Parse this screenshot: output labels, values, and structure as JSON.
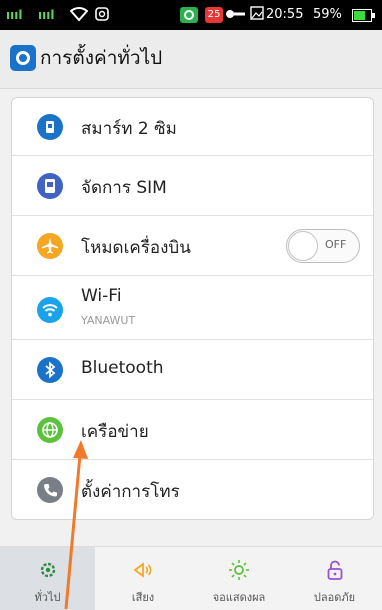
{
  "status_bar": {
    "signal1": "ıııl",
    "signal2": "ıııl",
    "wifi_icon": "wifi-icon",
    "screenshot_icon": "screenshot-icon",
    "badge_number": "25",
    "time": "20:55",
    "battery": "59%"
  },
  "header": {
    "title": "การตั้งค่าทั่วไป",
    "icon": "settings-icon"
  },
  "settings": {
    "smart_dual_sim": {
      "label": "สมาร์ท 2 ซิม",
      "icon": "sim-card-icon"
    },
    "manage_sim": {
      "label": "จัดการ SIM",
      "icon": "sim-manager-icon"
    },
    "airplane_mode": {
      "label": "โหมดเครื่องบิน",
      "icon": "airplane-icon",
      "toggle": "OFF"
    },
    "wifi": {
      "label": "Wi-Fi",
      "sublabel": "YANAWUT",
      "icon": "wifi-icon"
    },
    "bluetooth": {
      "label": "Bluetooth",
      "icon": "bluetooth-icon"
    },
    "network": {
      "label": "เครือข่าย",
      "icon": "globe-icon"
    },
    "call_settings": {
      "label": "ตั้งค่าการโทร",
      "icon": "phone-icon"
    }
  },
  "tabs": [
    {
      "label": "ทั่วไป",
      "icon": "gear-icon",
      "active": true
    },
    {
      "label": "เสียง",
      "icon": "speaker-icon",
      "active": false
    },
    {
      "label": "จอแสดงผล",
      "icon": "brightness-icon",
      "active": false
    },
    {
      "label": "ปลอดภัย",
      "icon": "lock-icon",
      "active": false
    }
  ],
  "colors": {
    "status_bar": "#000000",
    "accent_blue": "#1a73c9",
    "airplane_orange": "#f5a623",
    "wifi_blue": "#1aa3e8",
    "network_green": "#5cc13c",
    "annotation_arrow": "#f07a2a"
  }
}
